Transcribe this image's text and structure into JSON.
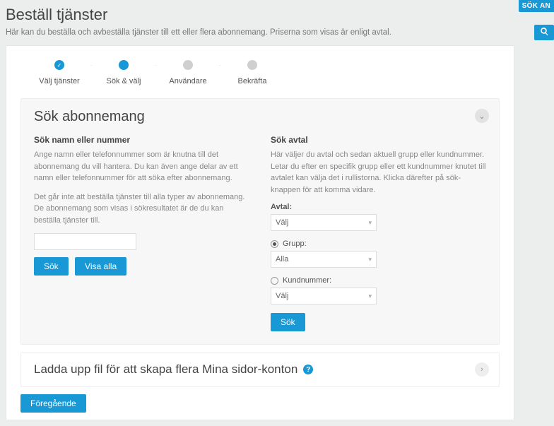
{
  "rightRail": {
    "tabLabel": "SÖK AN"
  },
  "page": {
    "title": "Beställ tjänster",
    "subtitle": "Här kan du beställa och avbeställa tjänster till ett eller flera abonnemang. Priserna som visas är enligt avtal."
  },
  "stepper": {
    "steps": [
      {
        "label": "Välj tjänster",
        "state": "done"
      },
      {
        "label": "Sök & välj",
        "state": "active"
      },
      {
        "label": "Användare",
        "state": "pending"
      },
      {
        "label": "Bekräfta",
        "state": "pending"
      }
    ]
  },
  "search": {
    "title": "Sök abonnemang",
    "left": {
      "heading": "Sök namn eller nummer",
      "help1": "Ange namn eller telefonnummer som är knutna till det abonnemang du vill hantera. Du kan även ange delar av ett namn eller telefonnummer för att söka efter abonnemang.",
      "help2": "Det går inte att beställa tjänster till alla typer av abonnemang. De abonnemang som visas i sökresultatet är de du kan beställa tjänster till.",
      "input_value": "",
      "btn_search": "Sök",
      "btn_showall": "Visa alla"
    },
    "right": {
      "heading": "Sök avtal",
      "help": "Här väljer du avtal och sedan aktuell grupp eller kundnummer. Letar du efter en specifik grupp eller ett kundnummer knutet till avtalet kan välja det i rullistorna. Klicka därefter på sök-knappen för att komma vidare.",
      "avtal_label": "Avtal:",
      "avtal_value": "Välj",
      "radio_group_label": "Grupp:",
      "group_value": "Alla",
      "radio_kund_label": "Kundnummer:",
      "kund_value": "Välj",
      "btn_search": "Sök"
    }
  },
  "upload": {
    "title": "Ladda upp fil för att skapa flera Mina sidor-konton"
  },
  "footer": {
    "prev": "Föregående"
  }
}
